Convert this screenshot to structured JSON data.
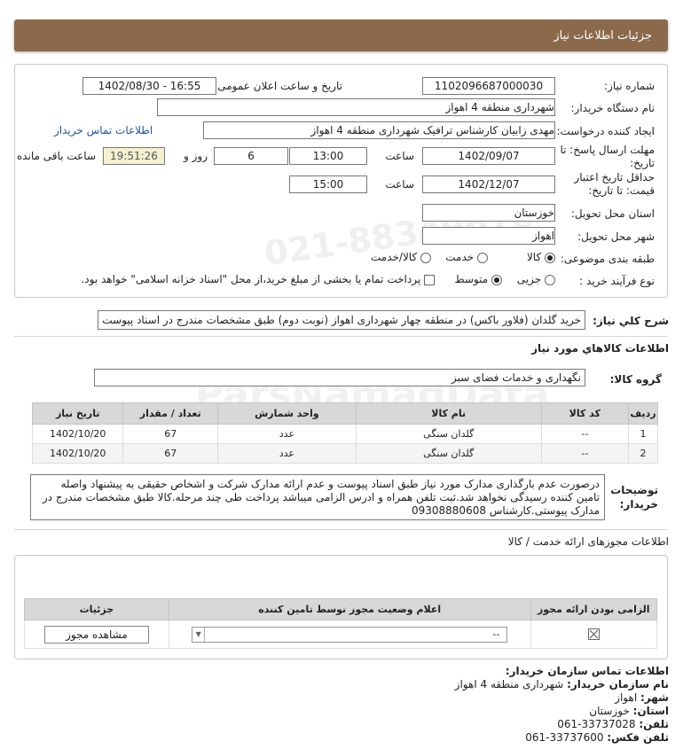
{
  "header": {
    "title": "جزئیات اطلاعات نیاز"
  },
  "fields": {
    "need_number_label": "شماره نیاز:",
    "need_number": "1102096687000030",
    "announce_label": "تاریخ و ساعت اعلان عمومی:",
    "announce_value": "1402/08/30 - 16:55",
    "buyer_org_label": "نام دستگاه خریدار:",
    "buyer_org": "شهرداری منطقه 4 اهواز",
    "creator_label": "ایجاد کننده درخواست:",
    "creator": "مهدی زابیان کارشناس ترافیک شهرداری منطقه 4 اهواز",
    "buyer_contact_link": "اطلاعات تماس خریدار",
    "deadline_label_1": "مهلت ارسال پاسخ: تا",
    "deadline_label_2": "تاریخ:",
    "deadline_date": "1402/09/07",
    "time_label": "ساعت",
    "deadline_time": "13:00",
    "days_value": "6",
    "days_label": "روز و",
    "remaining_time": "19:51:26",
    "remaining_label": "ساعت باقی مانده",
    "validity_label_1": "حداقل تاریخ اعتبار",
    "validity_label_2": "قیمت: تا تاریخ:",
    "validity_date": "1402/12/07",
    "validity_time": "15:00",
    "province_label": "استان محل تحویل:",
    "province": "خوزستان",
    "city_label": "شهر محل تحویل:",
    "city": "اهواز",
    "category_label": "طبقه بندی موضوعی:",
    "category_options": [
      "کالا",
      "خدمت",
      "کالا/خدمت"
    ],
    "process_label": "نوع فرآیند خرید :",
    "process_options": [
      "جزیی",
      "متوسط"
    ],
    "payment_note": "پرداخت تمام یا بخشی از مبلغ خرید،از محل \"اسناد خزانه اسلامی\" خواهد بود."
  },
  "description": {
    "label": "شرح کلي نياز:",
    "text": "خرید گلدان (فلاور باکس) در منطقه چهار شهرداری اهواز (نوبت دوم) طبق مشخصات مندرج در اسناد پیوست"
  },
  "goods": {
    "section_title": "اطلاعات كالاهاي مورد نياز",
    "group_label": "گروه کالا:",
    "group_value": "نگهداری و خدمات فضای سبز",
    "columns": [
      "ردیف",
      "کد کالا",
      "نام کالا",
      "واحد شمارش",
      "تعداد / مقدار",
      "تاریخ نیاز"
    ],
    "rows": [
      [
        "1",
        "--",
        "گلدان سنگی",
        "عدد",
        "67",
        "1402/10/20"
      ],
      [
        "2",
        "--",
        "گلدان سنگی",
        "عدد",
        "67",
        "1402/10/20"
      ]
    ]
  },
  "notes": {
    "label_1": "توضیحات",
    "label_2": "خریدار:",
    "text": "درصورت عدم بارگذاری مدارک مورد نیاز طبق اسناد پیوست و عدم ارائه مدارک شرکت و اشخاص حقیقی به پیشنهاد واصله تامین کننده رسیدگی نخواهد شد.ثبت تلفن همراه و ادرس الزامی میباشد پرداخت طی چند مرحله.کالا طبق مشخصات مندرج در مدارک پیوستی.کارشناس 09308880608"
  },
  "licenses": {
    "section_title": "اطلاعات مجوزهای ارائه خدمت / کالا",
    "columns": [
      "الزامی بودن ارائه مجوز",
      "اعلام وضعیت مجوز توسط تامین کننده",
      "جزئیات"
    ],
    "select_value": "--",
    "view_button": "مشاهده مجوز"
  },
  "contact": {
    "title": "اطلاعات تماس سازمان خریدار:",
    "org_label": "نام سازمان خریدار:",
    "org": "شهرداری منطقه 4 اهواز",
    "city_label": "شهر:",
    "city": "اهواز",
    "province_label": "استان:",
    "province": "خوزستان",
    "phone_label": "تلفن:",
    "phone": "061-33737028",
    "fax_label": "تلفن فکس:",
    "fax": "061-33737600"
  },
  "watermark": {
    "number": "021-88349670",
    "brand": "ParsNamadData"
  }
}
